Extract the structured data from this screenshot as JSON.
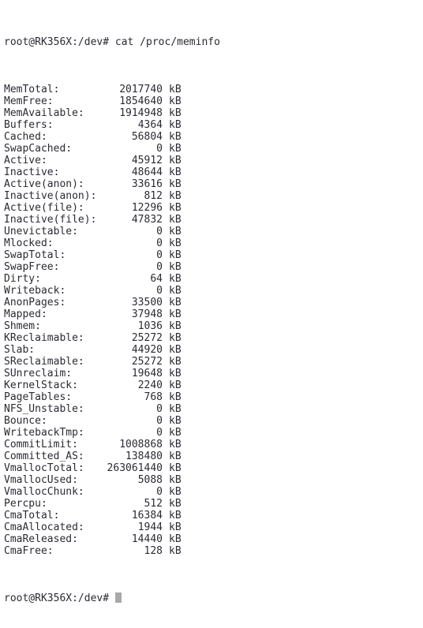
{
  "terminal": {
    "background_color": "#ffffff",
    "text_color": "#2a2a33",
    "cursor_color": "#a8a8a8",
    "prompt": "root@RK356X:/dev#",
    "command": "cat /proc/meminfo",
    "command_line": "root@RK356X:/dev# cat /proc/meminfo",
    "trailing_prompt": "root@RK356X:/dev# ",
    "unit": "kB",
    "rows": [
      {
        "label": "MemTotal:",
        "value": "2017740",
        "unit": "kB"
      },
      {
        "label": "MemFree:",
        "value": "1854640",
        "unit": "kB"
      },
      {
        "label": "MemAvailable:",
        "value": "1914948",
        "unit": "kB"
      },
      {
        "label": "Buffers:",
        "value": "4364",
        "unit": "kB"
      },
      {
        "label": "Cached:",
        "value": "56804",
        "unit": "kB"
      },
      {
        "label": "SwapCached:",
        "value": "0",
        "unit": "kB"
      },
      {
        "label": "Active:",
        "value": "45912",
        "unit": "kB"
      },
      {
        "label": "Inactive:",
        "value": "48644",
        "unit": "kB"
      },
      {
        "label": "Active(anon):",
        "value": "33616",
        "unit": "kB"
      },
      {
        "label": "Inactive(anon):",
        "value": "812",
        "unit": "kB"
      },
      {
        "label": "Active(file):",
        "value": "12296",
        "unit": "kB"
      },
      {
        "label": "Inactive(file):",
        "value": "47832",
        "unit": "kB"
      },
      {
        "label": "Unevictable:",
        "value": "0",
        "unit": "kB"
      },
      {
        "label": "Mlocked:",
        "value": "0",
        "unit": "kB"
      },
      {
        "label": "SwapTotal:",
        "value": "0",
        "unit": "kB"
      },
      {
        "label": "SwapFree:",
        "value": "0",
        "unit": "kB"
      },
      {
        "label": "Dirty:",
        "value": "64",
        "unit": "kB"
      },
      {
        "label": "Writeback:",
        "value": "0",
        "unit": "kB"
      },
      {
        "label": "AnonPages:",
        "value": "33500",
        "unit": "kB"
      },
      {
        "label": "Mapped:",
        "value": "37948",
        "unit": "kB"
      },
      {
        "label": "Shmem:",
        "value": "1036",
        "unit": "kB"
      },
      {
        "label": "KReclaimable:",
        "value": "25272",
        "unit": "kB"
      },
      {
        "label": "Slab:",
        "value": "44920",
        "unit": "kB"
      },
      {
        "label": "SReclaimable:",
        "value": "25272",
        "unit": "kB"
      },
      {
        "label": "SUnreclaim:",
        "value": "19648",
        "unit": "kB"
      },
      {
        "label": "KernelStack:",
        "value": "2240",
        "unit": "kB"
      },
      {
        "label": "PageTables:",
        "value": "768",
        "unit": "kB"
      },
      {
        "label": "NFS_Unstable:",
        "value": "0",
        "unit": "kB"
      },
      {
        "label": "Bounce:",
        "value": "0",
        "unit": "kB"
      },
      {
        "label": "WritebackTmp:",
        "value": "0",
        "unit": "kB"
      },
      {
        "label": "CommitLimit:",
        "value": "1008868",
        "unit": "kB"
      },
      {
        "label": "Committed_AS:",
        "value": "138480",
        "unit": "kB"
      },
      {
        "label": "VmallocTotal:",
        "value": "263061440",
        "unit": "kB"
      },
      {
        "label": "VmallocUsed:",
        "value": "5088",
        "unit": "kB"
      },
      {
        "label": "VmallocChunk:",
        "value": "0",
        "unit": "kB"
      },
      {
        "label": "Percpu:",
        "value": "512",
        "unit": "kB"
      },
      {
        "label": "CmaTotal:",
        "value": "16384",
        "unit": "kB"
      },
      {
        "label": "CmaAllocated:",
        "value": "1944",
        "unit": "kB"
      },
      {
        "label": "CmaReleased:",
        "value": "14440",
        "unit": "kB"
      },
      {
        "label": "CmaFree:",
        "value": "128",
        "unit": "kB"
      }
    ]
  }
}
